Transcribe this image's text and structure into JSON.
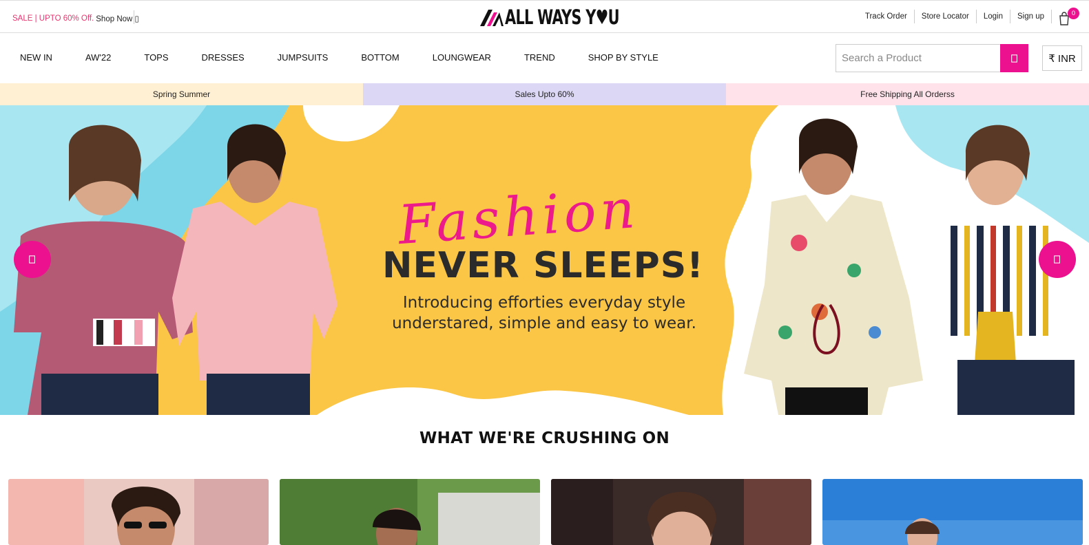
{
  "topbar": {
    "promo_sale": "SALE | UPTO 60% Off.",
    "promo_shop": "Shop Now ▯",
    "logo_text": "ALL WAYS Y♥U",
    "links": [
      "Track Order",
      "Store Locator",
      "Login",
      "Sign up"
    ],
    "cart_count": "0",
    "cart_icon": "cart-icon"
  },
  "nav": {
    "items": [
      "NEW IN",
      "AW'22",
      "TOPS",
      "DRESSES",
      "JUMPSUITS",
      "BOTTOM",
      "LOUNGWEAR",
      "TREND",
      "SHOP BY STYLE"
    ],
    "search_placeholder": "Search a Product",
    "search_icon": "search-icon",
    "currency": "₹ INR"
  },
  "strip": {
    "items": [
      "Spring Summer",
      "Sales Upto 60%",
      "Free Shipping All Orderss"
    ],
    "colors": [
      "#fff0d3",
      "#dcd7f5",
      "#ffe2ea"
    ]
  },
  "hero": {
    "script": "Fashion",
    "title": "NEVER SLEEPS!",
    "subtitle_line1": "Introducing efforties everyday style",
    "subtitle_line2": "understared, simple and easy to wear.",
    "prev_icon": "chevron-left-icon",
    "next_icon": "chevron-right-icon"
  },
  "section": {
    "title": "WHAT WE'RE CRUSHING ON"
  },
  "colors": {
    "accent": "#ec118f",
    "hero_bg": "#fbc646",
    "sale_text": "#e8336e"
  }
}
